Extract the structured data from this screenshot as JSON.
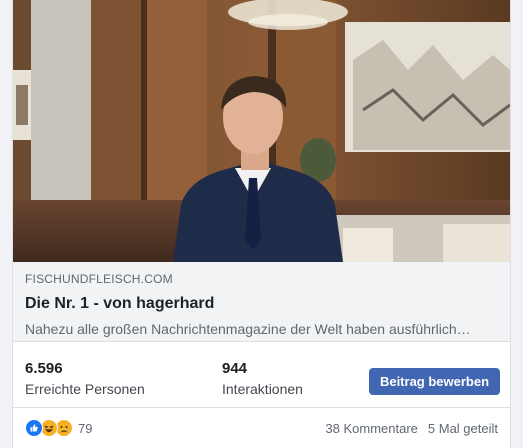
{
  "link": {
    "domain": "FISCHUNDFLEISCH.COM",
    "title": "Die Nr. 1 - von hagerhard",
    "description": "Nahezu alle großen Nachrichtenmagazine der Welt haben ausführlich…"
  },
  "stats": {
    "reach_value": "6.596",
    "reach_label": "Erreichte Personen",
    "interactions_value": "944",
    "interactions_label": "Interaktionen",
    "promote_label": "Beitrag bewerben"
  },
  "footer": {
    "reaction_icons": [
      "like-icon",
      "haha-icon",
      "sad-icon"
    ],
    "reaction_count": "79",
    "comments": "38 Kommentare",
    "shares": "5 Mal geteilt"
  },
  "colors": {
    "button": "#4267b2",
    "like": "#1877f2",
    "emoji": "#f7b125"
  }
}
